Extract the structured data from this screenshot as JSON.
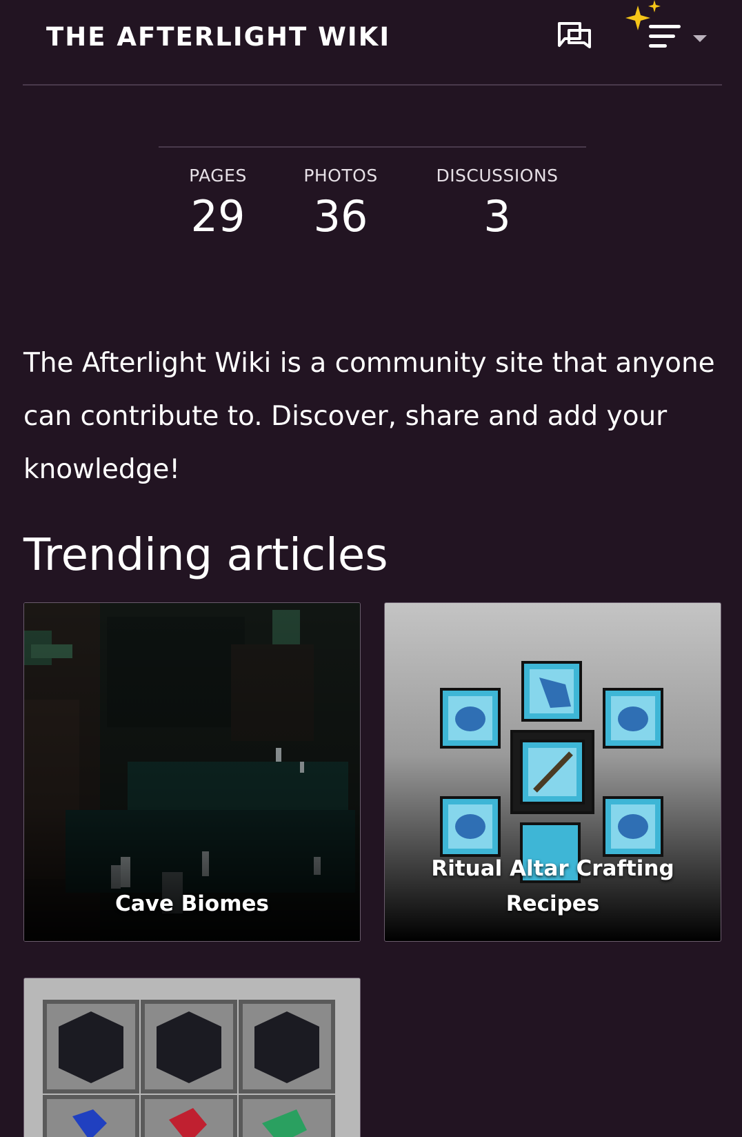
{
  "header": {
    "site_title": "THE AFTERLIGHT WIKI",
    "discussions_icon": "discussions-icon",
    "menu_icon": "menu-icon",
    "sparkle_icon": "sparkle-icon",
    "caret_icon": "caret-down-icon"
  },
  "stats": [
    {
      "label": "PAGES",
      "value": "29"
    },
    {
      "label": "PHOTOS",
      "value": "36"
    },
    {
      "label": "DISCUSSIONS",
      "value": "3"
    }
  ],
  "description": "The Afterlight Wiki is a community site that anyone can contribute to. Discover, share and add your knowledge!",
  "trending": {
    "title": "Trending articles",
    "articles": [
      {
        "label": "Cave Biomes"
      },
      {
        "label": "Ritual Altar Crafting Recipes"
      },
      {
        "label": ""
      }
    ]
  },
  "colors": {
    "background": "#221422",
    "divider": "#4a3a4c",
    "sparkle": "#f5c518",
    "text": "#ffffff"
  }
}
